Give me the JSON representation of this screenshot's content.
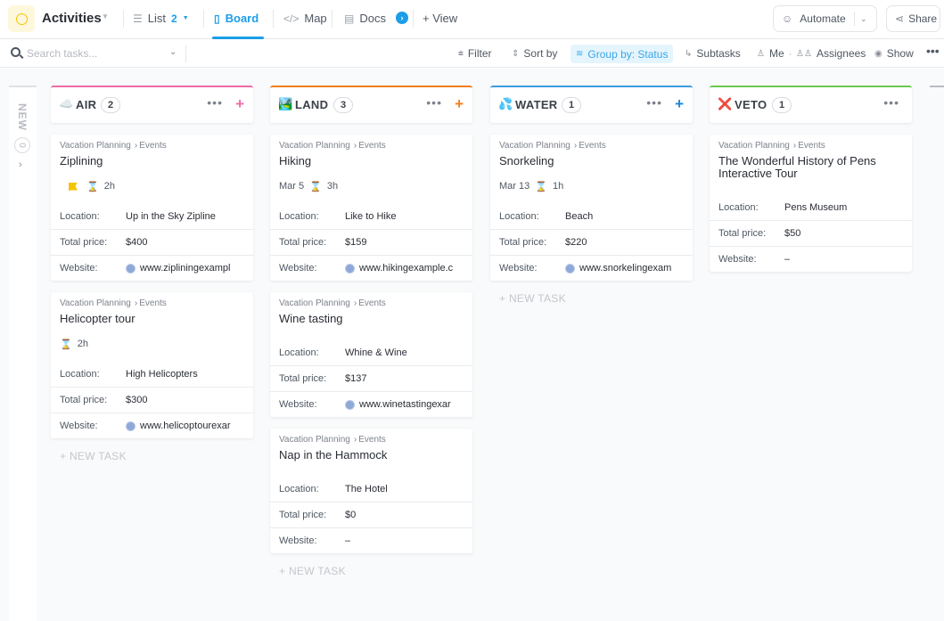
{
  "header": {
    "title": "Activities",
    "nav": [
      {
        "label": "List",
        "count": "2",
        "icon": "list-icon"
      },
      {
        "label": "Board",
        "icon": "board-icon",
        "active": true
      },
      {
        "label": "Map",
        "icon": "code-icon"
      },
      {
        "label": "Docs",
        "icon": "doc-icon"
      }
    ],
    "add_view_label": "+ View",
    "automate_label": "Automate",
    "share_label": "Share"
  },
  "toolbar": {
    "search_placeholder": "Search tasks...",
    "filter_label": "Filter",
    "sort_label": "Sort by",
    "group_label": "Group by: Status",
    "subtasks_label": "Subtasks",
    "me_label": "Me",
    "assignees_label": "Assignees",
    "show_label": "Show"
  },
  "board": {
    "collapsed": {
      "label": "NEW",
      "count": "0"
    },
    "new_task_label": "+ NEW TASK",
    "field_labels": {
      "location": "Location:",
      "price": "Total price:",
      "website": "Website:"
    },
    "columns": [
      {
        "name": "AIR",
        "emoji": "☁️",
        "count": "2",
        "color": "#f06ba8",
        "add_color": "#f06ba8",
        "cards": [
          {
            "breadcrumb": [
              "Vacation Planning",
              "Events"
            ],
            "title": "Ziplining",
            "flag": true,
            "date": "",
            "duration": "2h",
            "location": "Up in the Sky Zipline",
            "price": "$400",
            "website": "www.zipliningexampl"
          },
          {
            "breadcrumb": [
              "Vacation Planning",
              "Events"
            ],
            "title": "Helicopter tour",
            "flag": false,
            "date": "",
            "duration": "2h",
            "location": "High Helicopters",
            "price": "$300",
            "website": "www.helicoptourexar"
          }
        ]
      },
      {
        "name": "LAND",
        "emoji": "🏞️",
        "count": "3",
        "color": "#f07f1c",
        "add_color": "#f07f1c",
        "cards": [
          {
            "breadcrumb": [
              "Vacation Planning",
              "Events"
            ],
            "title": "Hiking",
            "flag": false,
            "date": "Mar 5",
            "duration": "3h",
            "location": "Like to Hike",
            "price": "$159",
            "website": "www.hikingexample.c"
          },
          {
            "breadcrumb": [
              "Vacation Planning",
              "Events"
            ],
            "title": "Wine tasting",
            "location": "Whine & Wine",
            "price": "$137",
            "website": "www.winetastingexar"
          },
          {
            "breadcrumb": [
              "Vacation Planning",
              "Events"
            ],
            "title": "Nap in the Hammock",
            "location": "The Hotel",
            "price": "$0",
            "website": "–"
          }
        ]
      },
      {
        "name": "WATER",
        "emoji": "💦",
        "count": "1",
        "color": "#3b9be0",
        "add_color": "#1c86d8",
        "cards": [
          {
            "breadcrumb": [
              "Vacation Planning",
              "Events"
            ],
            "title": "Snorkeling",
            "flag": false,
            "date": "Mar 13",
            "duration": "1h",
            "location": "Beach",
            "price": "$220",
            "website": "www.snorkelingexam"
          }
        ]
      },
      {
        "name": "VETO",
        "emoji": "❌",
        "count": "1",
        "color": "#6bc950",
        "add_color": "",
        "cards": [
          {
            "breadcrumb": [
              "Vacation Planning",
              "Events"
            ],
            "title": "The Wonderful History of Pens Interactive Tour",
            "location": "Pens Museum",
            "price": "$50",
            "website": "–"
          }
        ]
      }
    ]
  }
}
